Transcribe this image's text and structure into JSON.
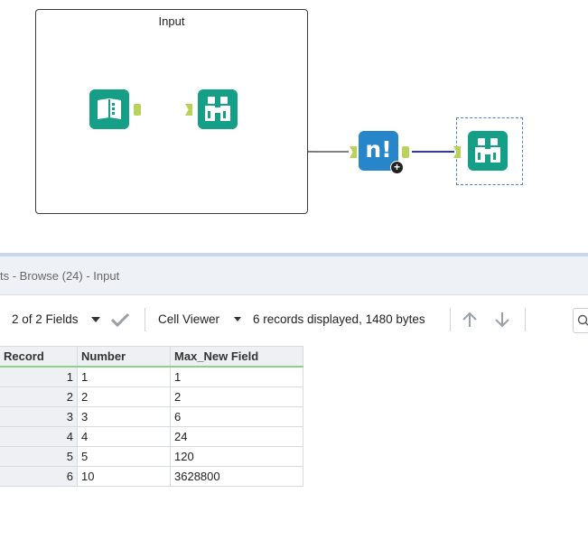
{
  "canvas": {
    "container_title": "Input",
    "tools": {
      "text_input_icon": "text-input-icon",
      "browse_icon": "binoculars-icon",
      "formula_label": "n!",
      "formula_badge": "+"
    }
  },
  "results": {
    "title": "ts - Browse (24) - Input",
    "fields_selector": "2 of 2 Fields",
    "cell_viewer": "Cell Viewer",
    "records_info": "6 records displayed, 1480 bytes"
  },
  "grid": {
    "headers": [
      "Record",
      "Number",
      "Max_New Field"
    ],
    "rows": [
      [
        "1",
        "1",
        "1"
      ],
      [
        "2",
        "2",
        "2"
      ],
      [
        "3",
        "3",
        "6"
      ],
      [
        "4",
        "4",
        "24"
      ],
      [
        "5",
        "5",
        "120"
      ],
      [
        "6",
        "10",
        "3628800"
      ]
    ]
  },
  "colors": {
    "tool_teal": "#159f86",
    "tool_blue": "#2786c9",
    "anchor_green": "#b9d25a",
    "connection_blue": "#2b36c9",
    "header_underline": "#8bd18b"
  }
}
